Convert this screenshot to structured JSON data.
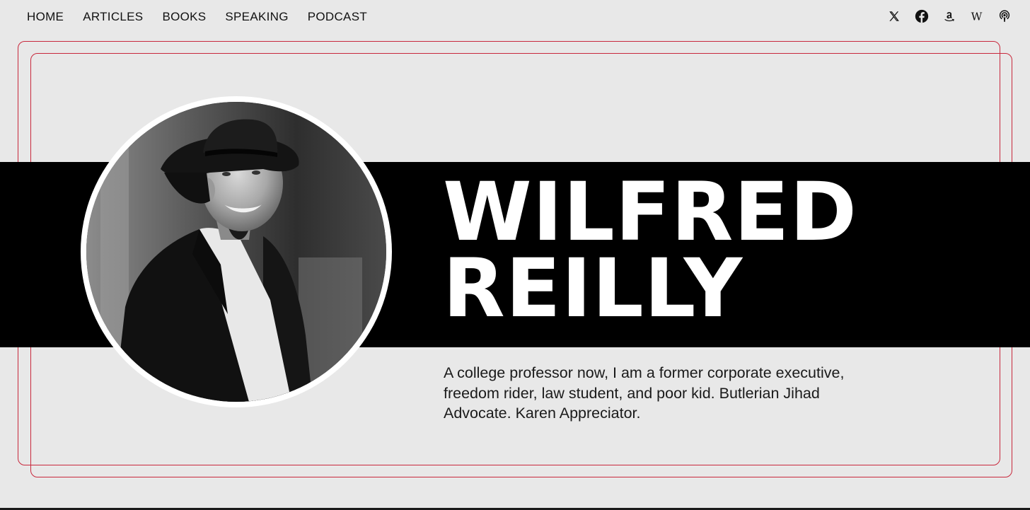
{
  "nav": {
    "links": [
      {
        "label": "HOME"
      },
      {
        "label": "ARTICLES"
      },
      {
        "label": "BOOKS"
      },
      {
        "label": "SPEAKING"
      },
      {
        "label": "PODCAST"
      }
    ]
  },
  "social": {
    "icons": [
      "x-icon",
      "facebook-icon",
      "amazon-icon",
      "wikipedia-icon",
      "podcast-icon"
    ]
  },
  "hero": {
    "name_line1": "WILFRED",
    "name_line2": "REILLY",
    "bio": "A college professor now, I am a former corporate executive, freedom rider, law student, and poor kid. Butlerian Jihad Advocate. Karen Appreciator."
  },
  "colors": {
    "background": "#e8e8e8",
    "band": "#000000",
    "frame": "#c8283c",
    "name": "#ffffff"
  }
}
